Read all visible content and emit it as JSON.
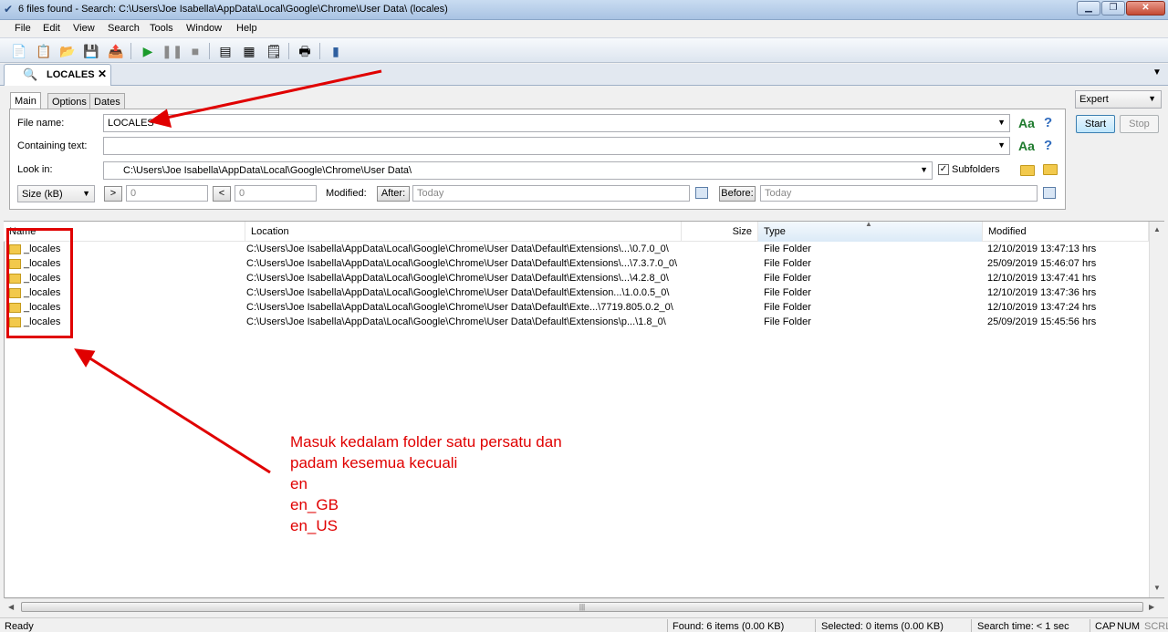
{
  "window": {
    "title": "6 files found - Search: C:\\Users\\Joe Isabella\\AppData\\Local\\Google\\Chrome\\User Data\\ (locales)",
    "controls": [
      "0",
      "1",
      "r"
    ]
  },
  "menu": [
    "File",
    "Edit",
    "View",
    "Search",
    "Tools",
    "Window",
    "Help"
  ],
  "tab": {
    "label": "LOCALES",
    "close": "✕"
  },
  "subtabs": [
    "Main",
    "Options",
    "Dates"
  ],
  "form": {
    "file_name_label": "File name:",
    "file_name_value": "LOCALES",
    "containing_label": "Containing text:",
    "containing_value": "",
    "look_in_label": "Look in:",
    "look_in_value": "C:\\Users\\Joe Isabella\\AppData\\Local\\Google\\Chrome\\User Data\\",
    "subfolders_label": "Subfolders",
    "subfolders_checked": "✓",
    "size_select": "Size (kB)",
    "gt_button": ">",
    "gt_value": "0",
    "lt_button": "<",
    "lt_value": "0",
    "modified_label": "Modified:",
    "after_button": "After:",
    "after_placeholder": "Today",
    "before_button": "Before:",
    "before_placeholder": "Today",
    "case_icon": "Aa",
    "help_icon": "?"
  },
  "side": {
    "mode": "Expert",
    "start": "Start",
    "stop": "Stop"
  },
  "columns": [
    "Name",
    "Location",
    "Size",
    "Type",
    "Modified"
  ],
  "rows": [
    {
      "name": "_locales",
      "location": "C:\\Users\\Joe Isabella\\AppData\\Local\\Google\\Chrome\\User Data\\Default\\Extensions\\...\\0.7.0_0\\",
      "size": "",
      "type": "File Folder",
      "modified": "12/10/2019 13:47:13 hrs"
    },
    {
      "name": "_locales",
      "location": "C:\\Users\\Joe Isabella\\AppData\\Local\\Google\\Chrome\\User Data\\Default\\Extensions\\...\\7.3.7.0_0\\",
      "size": "",
      "type": "File Folder",
      "modified": "25/09/2019 15:46:07 hrs"
    },
    {
      "name": "_locales",
      "location": "C:\\Users\\Joe Isabella\\AppData\\Local\\Google\\Chrome\\User Data\\Default\\Extensions\\...\\4.2.8_0\\",
      "size": "",
      "type": "File Folder",
      "modified": "12/10/2019 13:47:41 hrs"
    },
    {
      "name": "_locales",
      "location": "C:\\Users\\Joe Isabella\\AppData\\Local\\Google\\Chrome\\User Data\\Default\\Extension...\\1.0.0.5_0\\",
      "size": "",
      "type": "File Folder",
      "modified": "12/10/2019 13:47:36 hrs"
    },
    {
      "name": "_locales",
      "location": "C:\\Users\\Joe Isabella\\AppData\\Local\\Google\\Chrome\\User Data\\Default\\Exte...\\7719.805.0.2_0\\",
      "size": "",
      "type": "File Folder",
      "modified": "12/10/2019 13:47:24 hrs"
    },
    {
      "name": "_locales",
      "location": "C:\\Users\\Joe Isabella\\AppData\\Local\\Google\\Chrome\\User Data\\Default\\Extensions\\p...\\1.8_0\\",
      "size": "",
      "type": "File Folder",
      "modified": "25/09/2019 15:45:56 hrs"
    }
  ],
  "status": {
    "ready": "Ready",
    "found": "Found: 6 items (0.00 KB)",
    "selected": "Selected: 0 items (0.00 KB)",
    "time": "Search time: < 1 sec",
    "cap": "CAP",
    "num": "NUM",
    "scrl": "SCRL"
  },
  "annotation": {
    "lines": [
      "Masuk kedalam folder satu persatu dan",
      "padam kesemua kecuali",
      "en",
      "en_GB",
      "en_US"
    ],
    "color": "#e00000"
  },
  "icons": [
    "app-icon",
    "new-icon",
    "copy-icon",
    "open-icon",
    "save-icon",
    "export-icon",
    "play-icon",
    "pause-icon",
    "stop-icon",
    "view-icon",
    "window-icon",
    "report-icon",
    "print-icon",
    "book-icon",
    "search-icon",
    "folder-icon",
    "calendar-icon"
  ]
}
